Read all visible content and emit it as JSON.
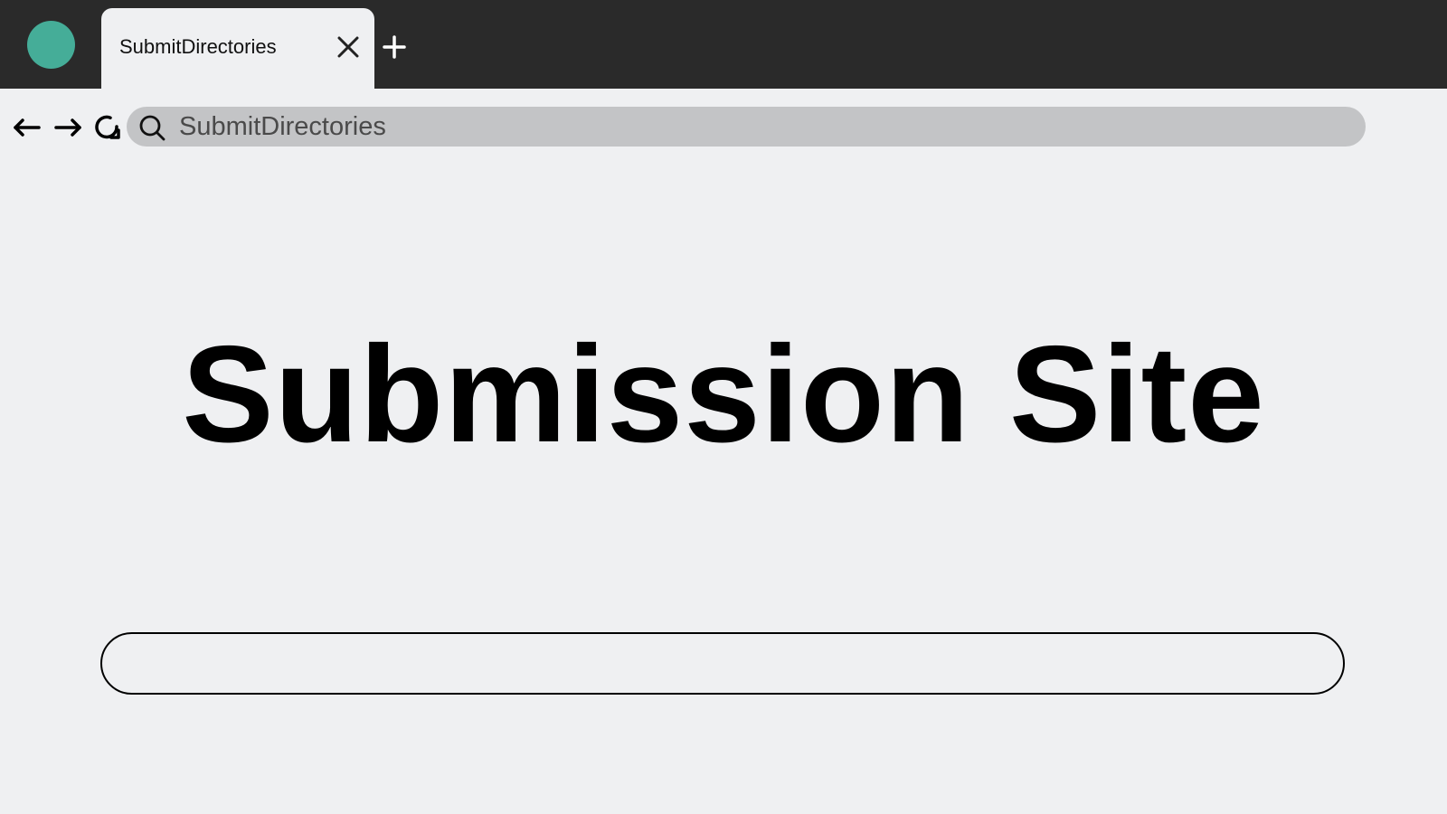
{
  "browser": {
    "tab": {
      "title": "SubmitDirectories",
      "close_icon": "close-icon"
    },
    "new_tab_icon": "plus-icon",
    "app_icon_color": "#45ad98",
    "nav": {
      "back_icon": "arrow-left-icon",
      "forward_icon": "arrow-right-icon",
      "reload_icon": "reload-icon"
    },
    "address_bar": {
      "search_icon": "search-icon",
      "text": "SubmitDirectories"
    }
  },
  "page": {
    "title": "Submission Site",
    "input": {
      "value": "",
      "placeholder": ""
    }
  }
}
